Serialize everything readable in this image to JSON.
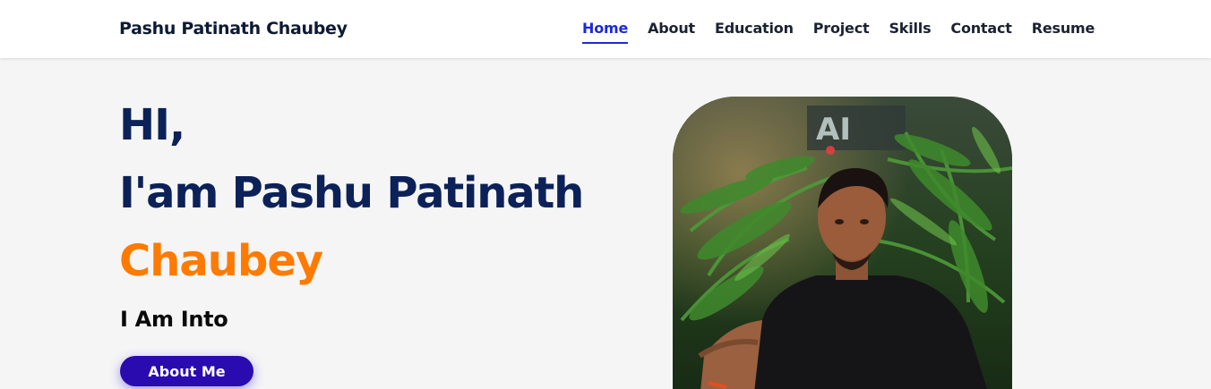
{
  "header": {
    "brand": "Pashu Patinath Chaubey",
    "nav": [
      {
        "label": "Home",
        "active": true
      },
      {
        "label": "About",
        "active": false
      },
      {
        "label": "Education",
        "active": false
      },
      {
        "label": "Project",
        "active": false
      },
      {
        "label": "Skills",
        "active": false
      },
      {
        "label": "Contact",
        "active": false
      },
      {
        "label": "Resume",
        "active": false
      }
    ]
  },
  "hero": {
    "greeting": "HI,",
    "intro": "I'am Pashu Patinath",
    "surname": "Chaubey",
    "tagline": "I Am Into",
    "button_label": "About Me",
    "sign_text": "AI"
  },
  "colors": {
    "primary_text": "#0b2158",
    "accent_orange": "#ff7a00",
    "nav_active": "#1d2bd4",
    "button_bg": "#2a0bb0",
    "page_bg": "#f5f5f5"
  }
}
